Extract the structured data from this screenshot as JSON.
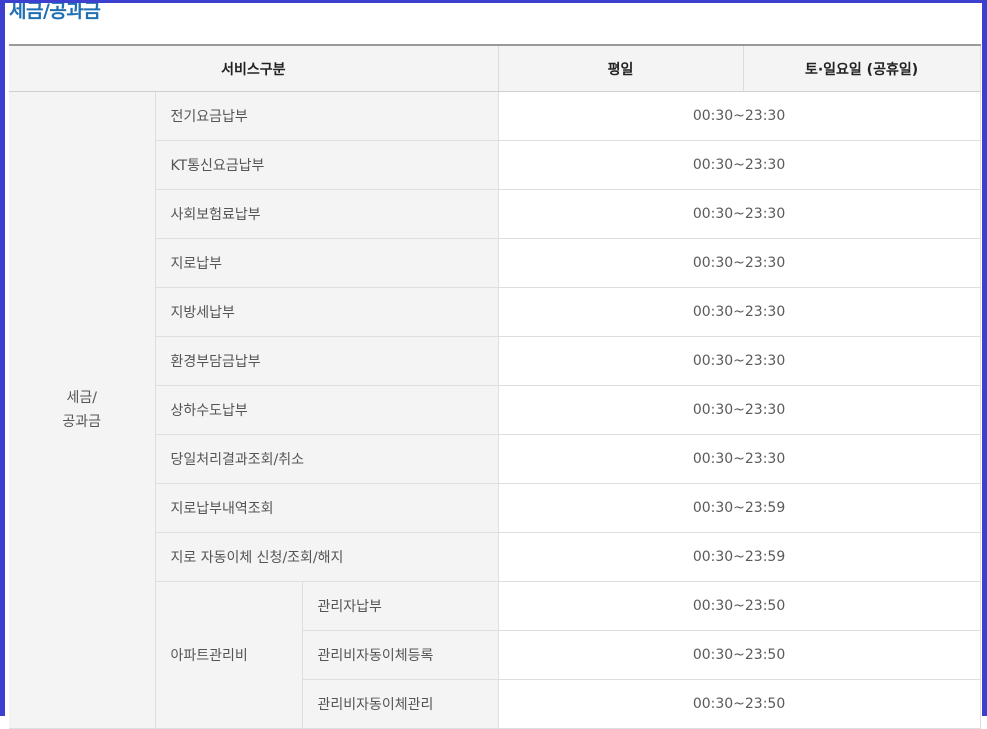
{
  "section": {
    "title": "세금/공과금"
  },
  "table": {
    "headers": [
      "서비스구분",
      "평일",
      "토·일요일 (공휴일)"
    ],
    "category": {
      "line1": "세금/",
      "line2": "공과금"
    },
    "rows": [
      {
        "service": "전기요금납부",
        "time": "00:30~23:30"
      },
      {
        "service": "KT통신요금납부",
        "time": "00:30~23:30"
      },
      {
        "service": "사회보험료납부",
        "time": "00:30~23:30"
      },
      {
        "service": "지로납부",
        "time": "00:30~23:30"
      },
      {
        "service": "지방세납부",
        "time": "00:30~23:30"
      },
      {
        "service": "환경부담금납부",
        "time": "00:30~23:30"
      },
      {
        "service": "상하수도납부",
        "time": "00:30~23:30"
      },
      {
        "service": "당일처리결과조회/취소",
        "time": "00:30~23:30"
      },
      {
        "service": "지로납부내역조회",
        "time": "00:30~23:59"
      },
      {
        "service": "지로 자동이체 신청/조회/해지",
        "time": "00:30~23:59"
      }
    ],
    "apartment": {
      "label": "아파트관리비",
      "rows": [
        {
          "service": "관리자납부",
          "time": "00:30~23:50"
        },
        {
          "service": "관리비자동이체등록",
          "time": "00:30~23:50"
        },
        {
          "service": "관리비자동이체관리",
          "time": "00:30~23:50"
        }
      ]
    }
  },
  "colors": {
    "frame": "#3d3fcf",
    "title": "#1f6fb3",
    "header_bg": "#f4f4f4"
  }
}
